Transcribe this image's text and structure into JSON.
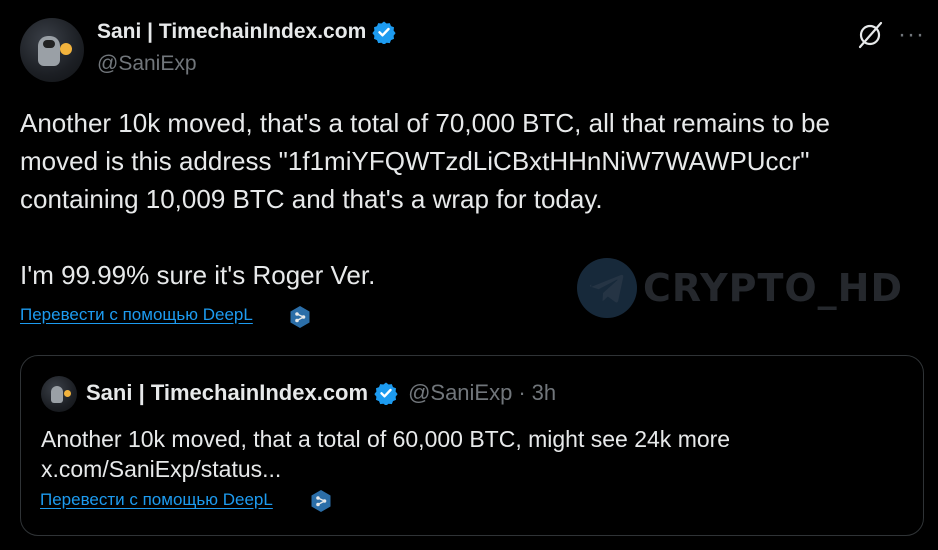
{
  "author": {
    "name": "Sani | TimechainIndex.com",
    "handle": "@SaniExp",
    "verified_icon": "verified-badge-icon",
    "badge_color": "#1d9bf0"
  },
  "header_actions": {
    "grok_icon": "grok-icon",
    "more_label": "···"
  },
  "tweet": {
    "lines": [
      "Another 10k moved, that's a total of 70,000 BTC, all that remains to be",
      "moved is this address \"1f1miYFQWTzdLiCBxtHHnNiW7WAWPUccr\"",
      "containing 10,009 BTC and that's a wrap for today."
    ],
    "line2": "I'm 99.99% sure it's Roger Ver.",
    "translate_label": "Перевести с помощью DeepL"
  },
  "watermark": {
    "text": "CRYPTO_HD",
    "icon": "telegram-icon"
  },
  "quote": {
    "name": "Sani | TimechainIndex.com",
    "handle": "@SaniExp",
    "separator": "·",
    "time": "3h",
    "text_line1": "Another 10k moved, that a total of 60,000 BTC, might see 24k more",
    "text_line2": "x.com/SaniExp/status...",
    "translate_label": "Перевести с помощью DeepL"
  },
  "colors": {
    "background": "#000000",
    "text": "#e7e9ea",
    "secondary": "#71767b",
    "link": "#1d9bf0",
    "border": "#2f3336"
  }
}
